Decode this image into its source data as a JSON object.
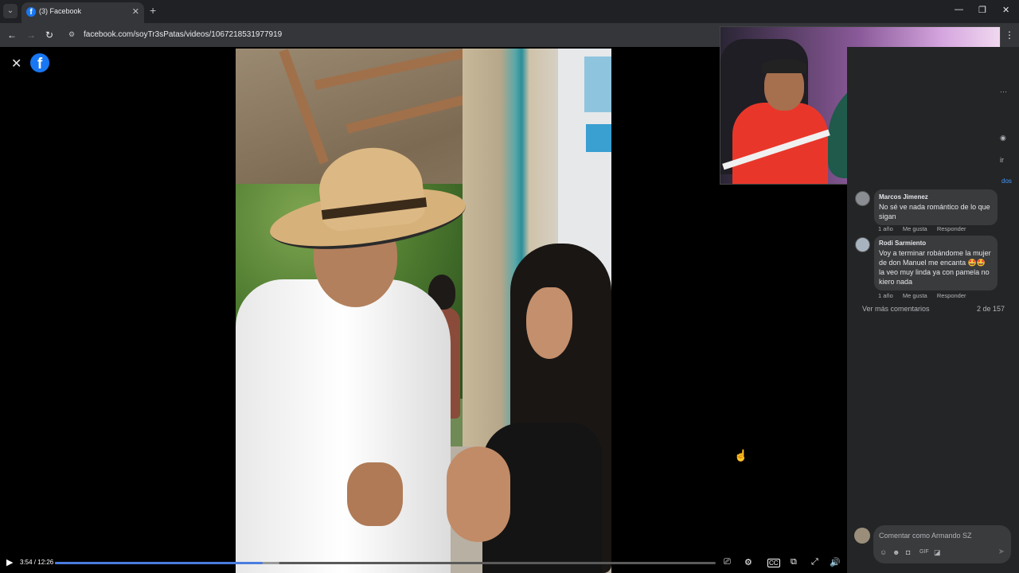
{
  "browser": {
    "tab_title": "(3) Facebook",
    "tab_favicon": "f",
    "tab_list_glyph": "⌄",
    "tab_close": "✕",
    "new_tab": "+",
    "url": "facebook.com/soyTr3sPatas/videos/1067218531977919",
    "minimize": "—",
    "restore": "❐",
    "close": "✕",
    "back": "←",
    "forward": "→",
    "reload": "↻",
    "menu": "⋮"
  },
  "viewer": {
    "close_glyph": "✕",
    "logo_glyph": "f"
  },
  "video": {
    "current_time": "3:54",
    "duration": "12:26",
    "time_display": "3:54 / 12:26",
    "played_fraction": 0.314,
    "buffered_fraction": 0.34,
    "play_glyph": "▶",
    "icons": [
      "captions-toggle-icon",
      "settings-icon",
      "cc-icon",
      "pip-icon",
      "fullscreen-icon",
      "volume-icon"
    ]
  },
  "comments": [
    {
      "name": "Marcos Jimenez",
      "text": "No sé ve nada romántico de lo que sigan",
      "age": "1 año",
      "like": "Me gusta",
      "reply": "Responder"
    },
    {
      "name": "Rodi Sarmiento",
      "text": "Voy a terminar robándome la mujer de don Manuel me encanta 🤩🤩 la veo muy linda ya con pamela no kiero nada",
      "age": "1 año",
      "like": "Me gusta",
      "reply": "Responder"
    }
  ],
  "panel": {
    "more_comments": "Ver más comentarios",
    "count": "2 de 157",
    "compose_placeholder": "Comentar como Armando SZ",
    "edge_fragment_1": "ir",
    "edge_fragment_2": "dos"
  }
}
